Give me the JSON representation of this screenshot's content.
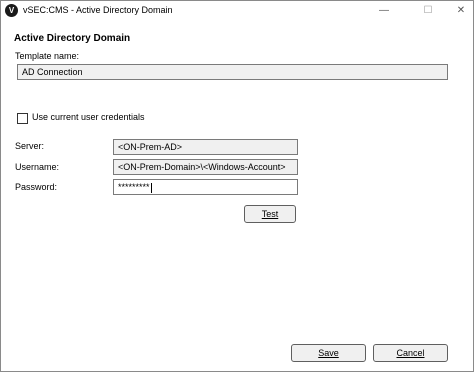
{
  "window": {
    "title": "vSEC:CMS - Active Directory Domain",
    "icon_glyph": "V",
    "min_glyph": "—",
    "max_glyph": "☐",
    "close_glyph": "✕"
  },
  "dialog": {
    "heading": "Active Directory Domain",
    "template_name_label": "Template name:",
    "template_name_value": "AD Connection",
    "use_current_credentials_label": "Use current user credentials",
    "use_current_credentials_checked": false,
    "server_label": "Server:",
    "server_value": "<ON-Prem-AD>",
    "username_label": "Username:",
    "username_value": "<ON-Prem-Domain>\\<Windows-Account>",
    "password_label": "Password:",
    "password_value": "*********",
    "test_button": "Test",
    "save_button": "Save",
    "cancel_button": "Cancel"
  }
}
